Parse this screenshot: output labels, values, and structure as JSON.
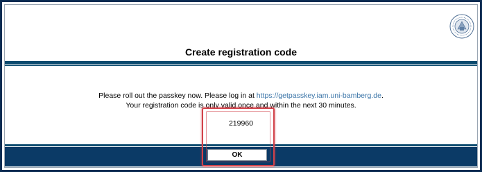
{
  "seal": {
    "icon": "university-seal-icon"
  },
  "page": {
    "title": "Create registration code"
  },
  "message": {
    "line1_prefix": "Please roll out the passkey now. Please log in at ",
    "link_text": "https://getpasskey.iam.uni-bamberg.de",
    "line1_suffix": ".",
    "line2": "Your registration code is only valid once and within the next 30 minutes."
  },
  "registration": {
    "code": "219960"
  },
  "actions": {
    "ok_label": "OK"
  },
  "colors": {
    "frame": "#0b2c52",
    "band": "#0b3a66",
    "bar": "#0b4a6e",
    "link": "#3b75a8",
    "highlight": "#d2424a"
  }
}
